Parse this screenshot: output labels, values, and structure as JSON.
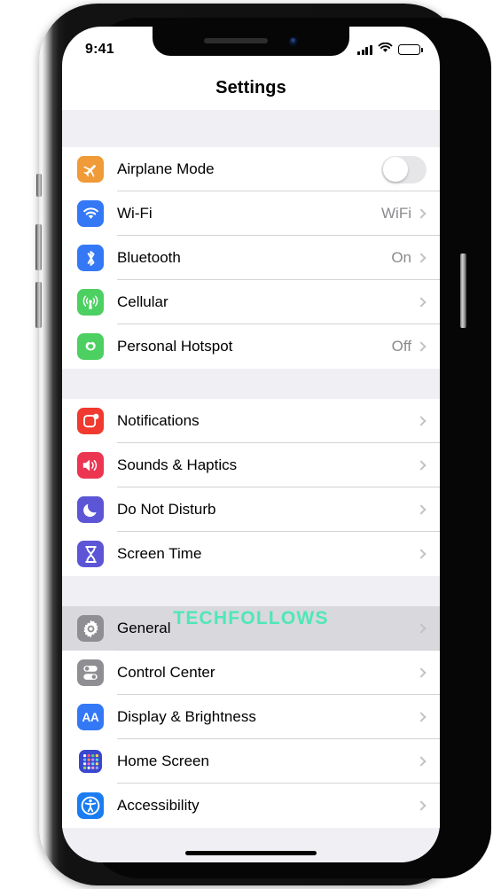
{
  "status_bar": {
    "time": "9:41",
    "signal_icon": "cellular-signal-icon",
    "wifi_icon": "wifi-icon",
    "battery_icon": "battery-full-icon"
  },
  "nav": {
    "title": "Settings"
  },
  "watermark": {
    "text": "TECHFOLLOWS",
    "color": "#4ee8b4"
  },
  "groups": [
    {
      "name": "connectivity",
      "rows": [
        {
          "label": "Airplane Mode",
          "icon": "airplane-icon",
          "icon_color": "#f09a38",
          "control": "toggle",
          "toggle_on": false,
          "value": ""
        },
        {
          "label": "Wi-Fi",
          "icon": "wifi-icon",
          "icon_color": "#3478f6",
          "control": "chevron",
          "value": "WiFi"
        },
        {
          "label": "Bluetooth",
          "icon": "bluetooth-icon",
          "icon_color": "#3478f6",
          "control": "chevron",
          "value": "On"
        },
        {
          "label": "Cellular",
          "icon": "cellular-antenna-icon",
          "icon_color": "#4cd061",
          "control": "chevron",
          "value": ""
        },
        {
          "label": "Personal Hotspot",
          "icon": "hotspot-link-icon",
          "icon_color": "#4cd061",
          "control": "chevron",
          "value": "Off"
        }
      ]
    },
    {
      "name": "alerts",
      "rows": [
        {
          "label": "Notifications",
          "icon": "notifications-badge-icon",
          "icon_color": "#f0392f",
          "control": "chevron",
          "value": ""
        },
        {
          "label": "Sounds & Haptics",
          "icon": "speaker-waves-icon",
          "icon_color": "#ec3551",
          "control": "chevron",
          "value": ""
        },
        {
          "label": "Do Not Disturb",
          "icon": "moon-icon",
          "icon_color": "#5c56d6",
          "control": "chevron",
          "value": ""
        },
        {
          "label": "Screen Time",
          "icon": "hourglass-icon",
          "icon_color": "#5c56d6",
          "control": "chevron",
          "value": ""
        }
      ]
    },
    {
      "name": "system",
      "rows": [
        {
          "label": "General",
          "icon": "gear-icon",
          "icon_color": "#8e8e93",
          "control": "chevron",
          "value": "",
          "selected": true
        },
        {
          "label": "Control Center",
          "icon": "control-center-icon",
          "icon_color": "#8e8e93",
          "control": "chevron",
          "value": ""
        },
        {
          "label": "Display & Brightness",
          "icon": "display-brightness-aa-icon",
          "icon_color": "#3478f6",
          "control": "chevron",
          "value": ""
        },
        {
          "label": "Home Screen",
          "icon": "home-screen-grid-icon",
          "icon_color": "#3a47cf",
          "control": "chevron",
          "value": ""
        },
        {
          "label": "Accessibility",
          "icon": "accessibility-icon",
          "icon_color": "#1a7cf0",
          "control": "chevron",
          "value": ""
        }
      ]
    }
  ]
}
